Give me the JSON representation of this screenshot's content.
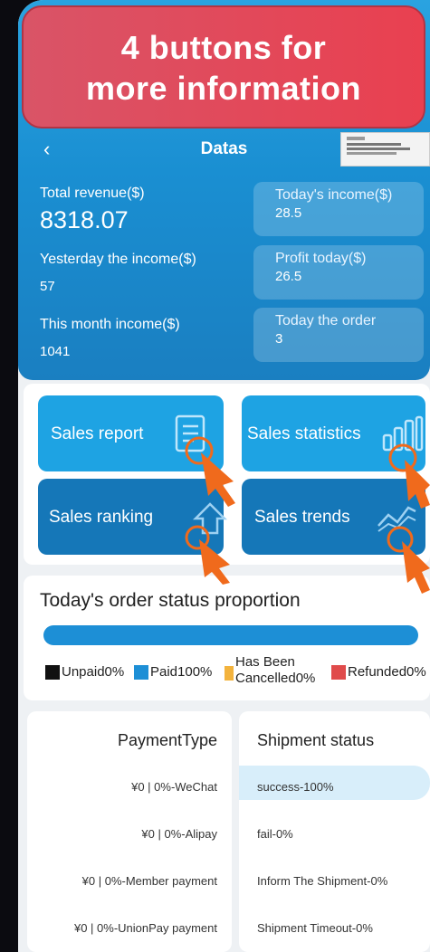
{
  "banner": {
    "line1": "4 buttons for",
    "line2": "more information"
  },
  "nav": {
    "back": "‹",
    "title": "Datas"
  },
  "revenue": {
    "total_label": "Total revenue($)",
    "total_value": "8318.07",
    "yesterday_label": "Yesterday the income($)",
    "yesterday_value": "57",
    "month_label": "This month income($)",
    "month_value": "1041"
  },
  "pills": [
    {
      "label": "Today's income($)",
      "value": "28.5"
    },
    {
      "label": "Profit today($)",
      "value": "26.5"
    },
    {
      "label": "Today the order",
      "value": "3"
    }
  ],
  "tiles": [
    {
      "label": "Sales report",
      "icon": "document-icon"
    },
    {
      "label": "Sales statistics",
      "icon": "bar-chart-icon"
    },
    {
      "label": "Sales ranking",
      "icon": "ranking-icon"
    },
    {
      "label": "Sales trends",
      "icon": "trend-chart-icon"
    }
  ],
  "order_status": {
    "title": "Today's order status proportion",
    "legend": [
      {
        "label": "Unpaid0%",
        "color": "#111111"
      },
      {
        "label": "Paid100%",
        "color": "#1d8fd6"
      },
      {
        "label1": "Has Been",
        "label2": "Cancelled0%",
        "color": "#f3b33d"
      },
      {
        "label": "Refunded0%",
        "color": "#e04b4b"
      }
    ]
  },
  "payment": {
    "title": "PaymentType",
    "rows": [
      "¥0 | 0%-WeChat",
      "¥0 | 0%-Alipay",
      "¥0 | 0%-Member payment",
      "¥0 | 0%-UnionPay payment"
    ]
  },
  "shipment": {
    "title": "Shipment status",
    "rows": [
      "success-100%",
      "fail-0%",
      "Inform The Shipment-0%",
      "Shipment Timeout-0%"
    ]
  },
  "colors": {
    "header": "#1a8fd2",
    "tile_light": "#1ea3e3",
    "tile_dark": "#1577b8",
    "banner": "#e04b5c",
    "hand": "#f06a1c"
  }
}
